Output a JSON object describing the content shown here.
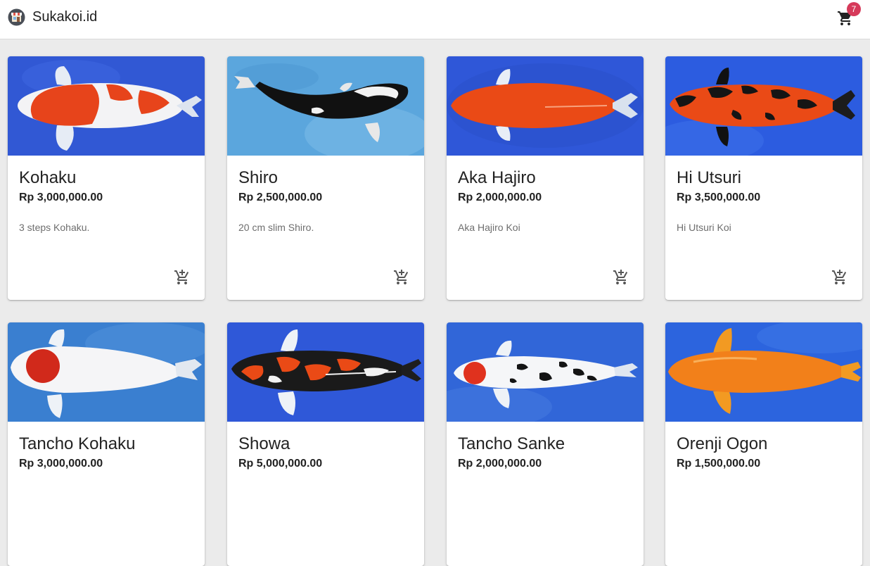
{
  "app": {
    "title": "Sukakoi.id",
    "logo_icon": "shop-icon",
    "cart_icon": "shopping-cart-icon",
    "cart_count": "7"
  },
  "colors": {
    "badge": "#d63a5a",
    "water_blue": "#2f57d8",
    "koi_red": "#e8461e",
    "koi_orange": "#f08a1e"
  },
  "products": [
    {
      "name": "Kohaku",
      "price": "Rp 3,000,000.00",
      "description": "3 steps Kohaku.",
      "action_icon": "add-shopping-cart-icon"
    },
    {
      "name": "Shiro",
      "price": "Rp 2,500,000.00",
      "description": "20 cm slim Shiro.",
      "action_icon": "add-shopping-cart-icon"
    },
    {
      "name": "Aka Hajiro",
      "price": "Rp 2,000,000.00",
      "description": "Aka Hajiro Koi",
      "action_icon": "add-shopping-cart-icon"
    },
    {
      "name": "Hi Utsuri",
      "price": "Rp 3,500,000.00",
      "description": "Hi Utsuri Koi",
      "action_icon": "add-shopping-cart-icon"
    },
    {
      "name": "Tancho Kohaku",
      "price": "Rp 3,000,000.00"
    },
    {
      "name": "Showa",
      "price": "Rp 5,000,000.00"
    },
    {
      "name": "Tancho Sanke",
      "price": "Rp 2,000,000.00"
    },
    {
      "name": "Orenji Ogon",
      "price": "Rp 1,500,000.00"
    }
  ]
}
